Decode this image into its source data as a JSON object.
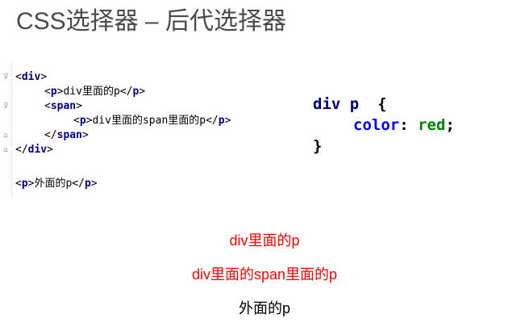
{
  "slide": {
    "title": "CSS选择器 – 后代选择器"
  },
  "colors": {
    "tag": "#000080",
    "property": "#0000ff",
    "value": "#008000",
    "highlighted_text": "#ff0000",
    "normal_text": "#000000"
  },
  "html_code": {
    "line1_open": "<",
    "line1_tag": "div",
    "line1_close": ">",
    "line2_open": "<",
    "line2_tag": "p",
    "line2_mid": ">div里面的p</",
    "line2_tag2": "p",
    "line2_close": ">",
    "line3_open": "<",
    "line3_tag": "span",
    "line3_close": ">",
    "line4_open": "<",
    "line4_tag": "p",
    "line4_mid": ">div里面的span里面的p</",
    "line4_tag2": "p",
    "line4_close": ">",
    "line5_open": "</",
    "line5_tag": "span",
    "line5_close": ">",
    "line6_open": "</",
    "line6_tag": "div",
    "line6_close": ">",
    "line7_open": "<",
    "line7_tag": "p",
    "line7_mid": ">外面的p</",
    "line7_tag2": "p",
    "line7_close": ">"
  },
  "css_code": {
    "selector": "div p",
    "open_brace": "{",
    "property": "color",
    "colon": ":",
    "value": "red",
    "semicolon": ";",
    "close_brace": "}"
  },
  "rendered_output": {
    "line1": "div里面的p",
    "line2": "div里面的span里面的p",
    "line3": "外面的p"
  },
  "icons": {
    "fold_open": "fold-open-icon",
    "fold_end": "fold-end-icon"
  }
}
